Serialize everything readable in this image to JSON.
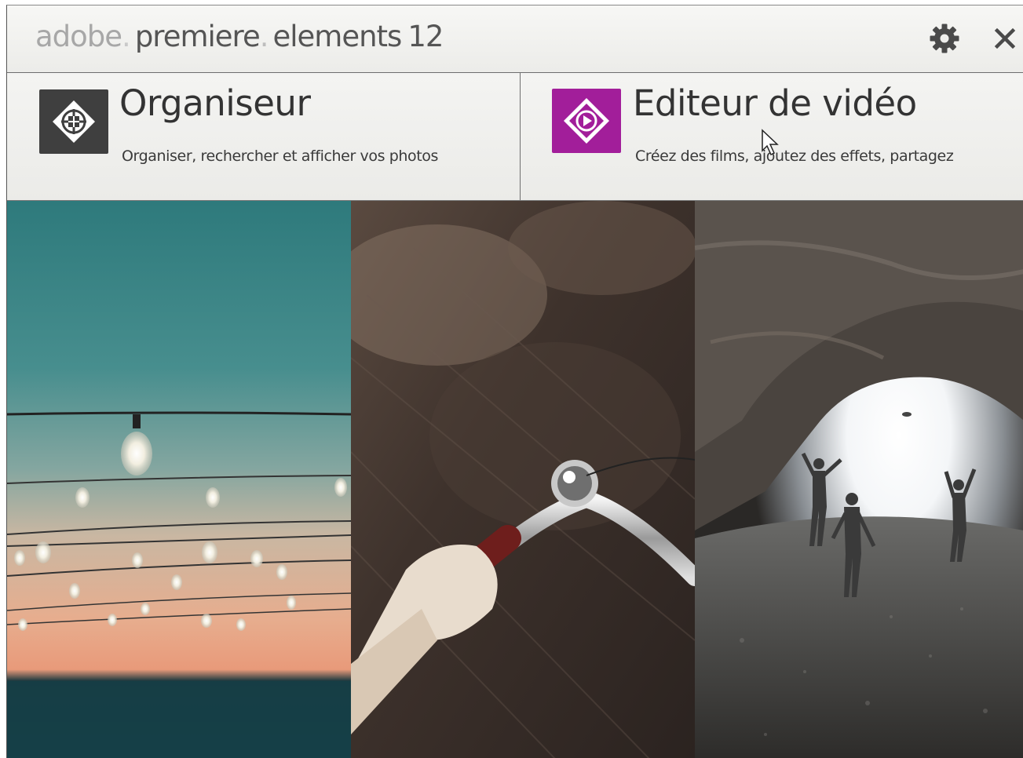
{
  "app": {
    "brand_adobe": "adobe",
    "brand_premiere": "premiere",
    "brand_elements": "elements",
    "version": "12"
  },
  "titlebar_icons": {
    "settings": "gear-icon",
    "close": "close-icon"
  },
  "modules": [
    {
      "title": "Organiseur",
      "subtitle": "Organiser, rechercher et afficher vos photos",
      "icon": "organizer-icon",
      "icon_color": "#3f3f3f"
    },
    {
      "title": "Editeur de vidéo",
      "subtitle": "Créez des films, ajoutez des effets, partagez",
      "icon": "video-editor-icon",
      "icon_color": "#a21e9a"
    }
  ],
  "colors": {
    "titlebar_bg": "#f2f2f0",
    "text_dark": "#333333",
    "brand_light": "#a7a7a7",
    "video_accent": "#a21e9a"
  }
}
